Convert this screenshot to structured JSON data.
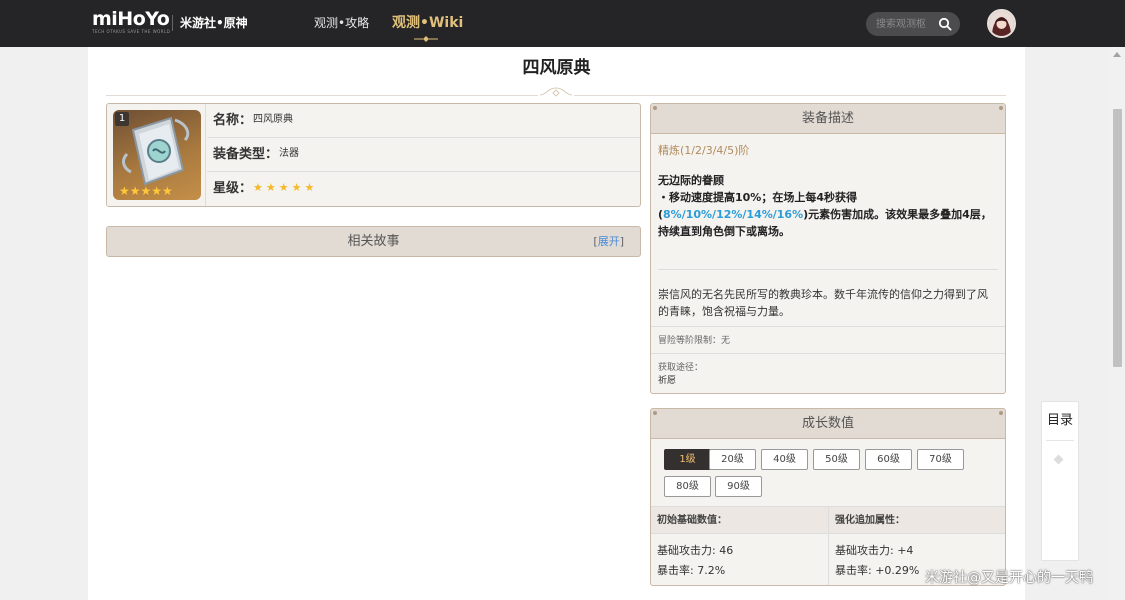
{
  "header": {
    "logo_text": "miHoYo",
    "logo_tagline": "TECH OTAKUS SAVE THE WORLD",
    "site_name": "米游社•原神",
    "nav_guide": "观测•攻略",
    "nav_wiki": "观测•Wiki",
    "search_placeholder": "搜索观测枢",
    "icons": {
      "search": "search-icon",
      "avatar": "user-avatar"
    }
  },
  "page": {
    "title": "四风原典"
  },
  "item_info": {
    "refine_level": "1",
    "rarity": 5,
    "rows": [
      {
        "key": "名称：",
        "value": "四风原典"
      },
      {
        "key": "装备类型：",
        "value": "法器"
      },
      {
        "key": "星级：",
        "value": "★★★★★"
      }
    ]
  },
  "story": {
    "title": "相关故事",
    "expand_open": "[",
    "expand_label": "展开",
    "expand_close": "]"
  },
  "description": {
    "title": "装备描述",
    "refine_label": "精炼(1/2/3/4/5)阶",
    "skill_name": "无边际的眷顾",
    "skill_prefix": "・移动速度提高10%；在场上每4秒获得(",
    "skill_highlight1": "8%/10%/12%/14%/",
    "skill_highlight2": "16%",
    "skill_suffix": ")元素伤害加成。该效果最多叠加4层，持续直到角色倒下或离场。",
    "lore": "崇信风的无名先民所写的教典珍本。数千年流传的信仰之力得到了风的青睐，饱含祝福与力量。",
    "level_limit": "冒险等阶限制：无",
    "source_label": "获取途径：",
    "source_value": "祈愿"
  },
  "growth": {
    "title": "成长数值",
    "levels": [
      "1级",
      "20级",
      "40级",
      "50级",
      "60级",
      "70级",
      "80级",
      "90级"
    ],
    "active_level": "1级",
    "base_header": "初始基础数值：",
    "bonus_header": "强化追加属性：",
    "base_values": [
      "基础攻击力: 46",
      "暴击率: 7.2%"
    ],
    "bonus_values": [
      "基础攻击力: +4",
      "暴击率: +0.29%"
    ]
  },
  "toc": {
    "title": "目录"
  },
  "watermark": "米游社@又是开心的一天鸭",
  "colors": {
    "topbar": "#252527",
    "card_border": "#c9b9a8",
    "card_head": "#e2dbd3",
    "highlight": "#2a9dd9",
    "refine_label": "#b08b5c",
    "wiki_gold": "#e0c07a",
    "star": "#f5b82a"
  }
}
